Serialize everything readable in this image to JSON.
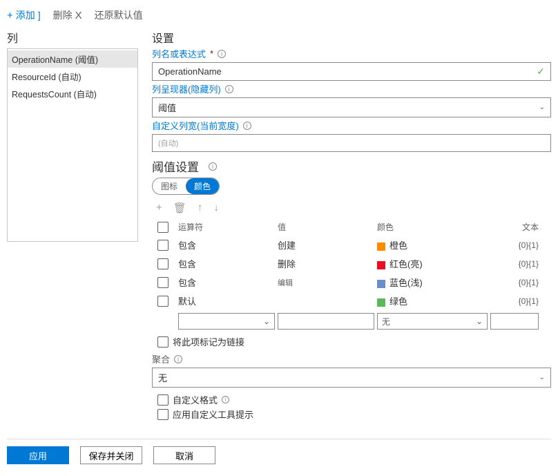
{
  "toolbar": {
    "add": "添加",
    "delete": "删除",
    "restore": "还原默认值"
  },
  "left": {
    "header": "列",
    "items": [
      "OperationName (阈值)",
      "ResourceId (自动)",
      "RequestsCount (自动)"
    ]
  },
  "settings": {
    "header": "设置",
    "colNameLabel": "列名或表达式",
    "colNameValue": "OperationName",
    "rendererLabel": "列呈现器(隐藏列)",
    "rendererValue": "阈值",
    "customWidthLabel": "自定义列宽(当前宽度)",
    "customWidthPlaceholder": "(自动)"
  },
  "thresholds": {
    "header": "阈值设置",
    "toggle": {
      "icon": "图标",
      "color": "颜色"
    },
    "columns": {
      "operator": "运算符",
      "value": "值",
      "color": "颜色",
      "text": "文本"
    },
    "rows": [
      {
        "operator": "包含",
        "value": "创建",
        "swatch": "sw-orange",
        "color": "橙色",
        "text": "{0}{1}"
      },
      {
        "operator": "包含",
        "value": "删除",
        "swatch": "sw-red",
        "color": "红色(亮)",
        "text": "{0}{1}"
      },
      {
        "operator": "包含",
        "value": "编辑",
        "swatch": "sw-blue",
        "color": "蓝色(浅)",
        "text": "{0}{1}"
      },
      {
        "operator": "默认",
        "value": "",
        "swatch": "sw-green",
        "color": "绿色",
        "text": "{0}{1}"
      }
    ],
    "noneLabel": "无"
  },
  "options": {
    "makeLink": "将此项标记为链接",
    "aggLabel": "聚合",
    "aggValue": "无",
    "customFormat": "自定义格式",
    "tooltip": "应用自定义工具提示"
  },
  "footer": {
    "apply": "应用",
    "saveClose": "保存并关闭",
    "cancel": "取消"
  }
}
